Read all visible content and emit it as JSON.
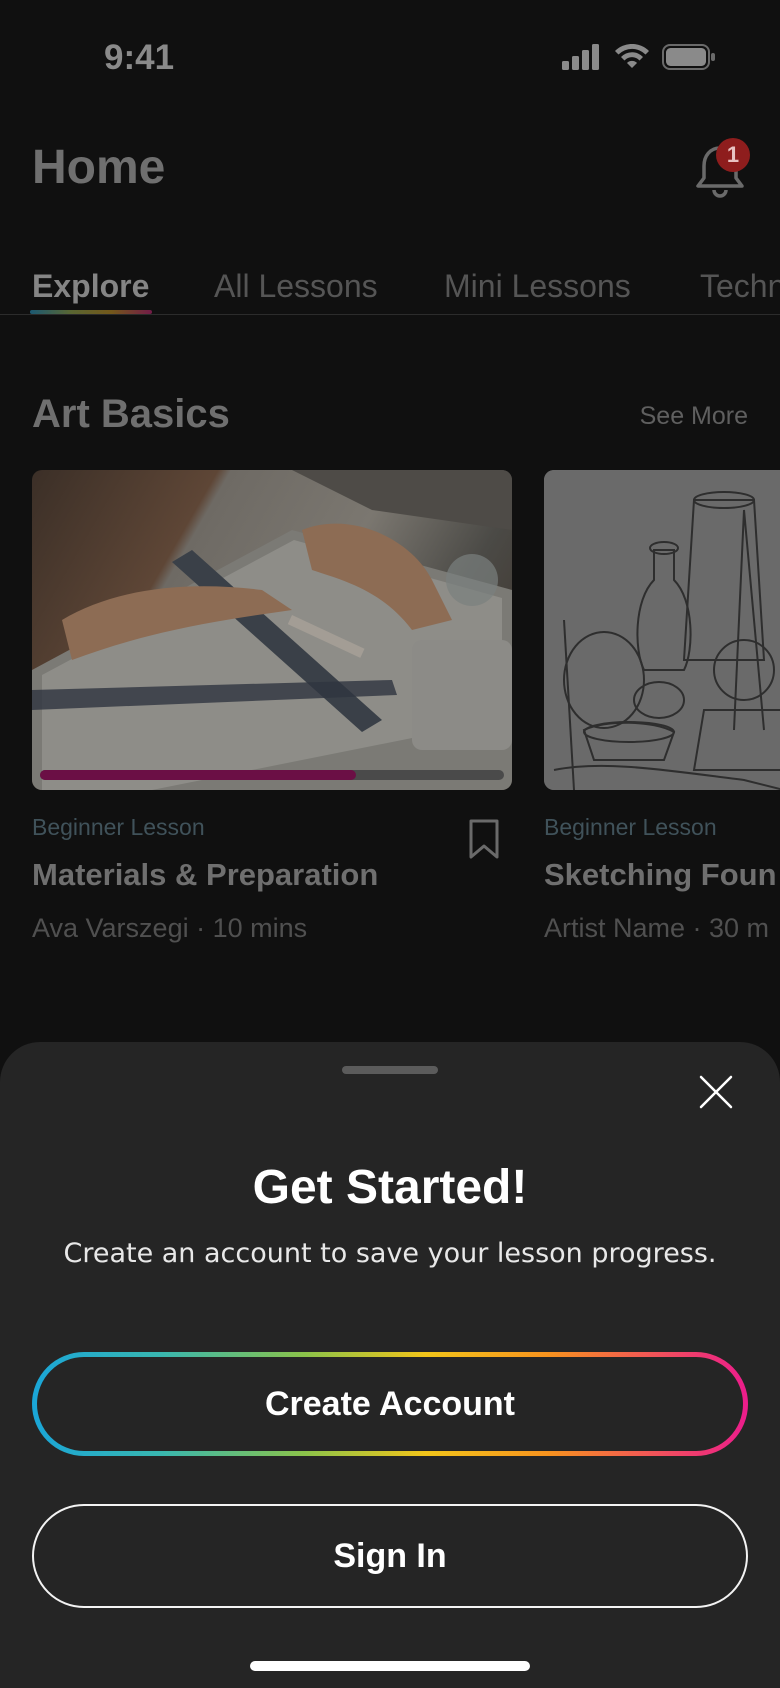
{
  "status_bar": {
    "time": "9:41",
    "icons": [
      "signal-icon",
      "wifi-icon",
      "battery-icon"
    ]
  },
  "header": {
    "title": "Home",
    "notification_count": "1"
  },
  "tabs": [
    {
      "label": "Explore",
      "active": true
    },
    {
      "label": "All Lessons",
      "active": false
    },
    {
      "label": "Mini Lessons",
      "active": false
    },
    {
      "label": "Techn",
      "active": false
    }
  ],
  "section": {
    "title": "Art Basics",
    "see_more": "See More"
  },
  "cards": [
    {
      "tag": "Beginner Lesson",
      "title": "Materials & Preparation",
      "meta": "Ava Varszegi · 10 mins",
      "progress": 0.68
    },
    {
      "tag": "Beginner Lesson",
      "title": "Sketching Foun",
      "meta": "Artist Name · 30 m"
    }
  ],
  "sheet": {
    "title": "Get Started!",
    "subtitle": "Create an account to save your lesson progress.",
    "create_account": "Create Account",
    "sign_in": "Sign In"
  },
  "colors": {
    "badge": "#8e1d1d",
    "progress": "#6b0f45",
    "sheet_bg": "#252525",
    "gradient": [
      "#1aa6d8",
      "#8bc34a",
      "#f2c51a",
      "#f7931e",
      "#ec1c8c"
    ]
  }
}
